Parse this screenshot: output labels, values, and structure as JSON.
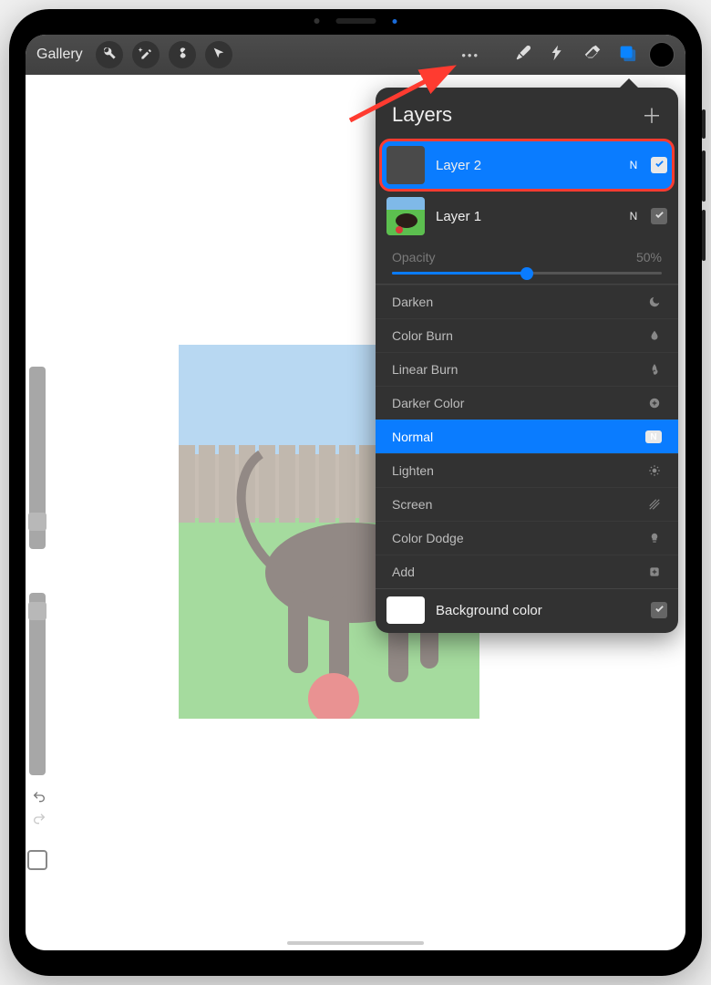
{
  "toolbar": {
    "gallery_label": "Gallery"
  },
  "layers_panel": {
    "title": "Layers",
    "layers": [
      {
        "name": "Layer 2",
        "mode_badge": "N",
        "selected": true,
        "thumb": "blank"
      },
      {
        "name": "Layer 1",
        "mode_badge": "N",
        "selected": false,
        "thumb": "photo"
      }
    ],
    "opacity_label": "Opacity",
    "opacity_value": "50%",
    "opacity_percent": 50,
    "blend_modes": [
      {
        "name": "Darken",
        "icon": "moon"
      },
      {
        "name": "Color Burn",
        "icon": "drop"
      },
      {
        "name": "Linear Burn",
        "icon": "flame"
      },
      {
        "name": "Darker Color",
        "icon": "circle-plus"
      },
      {
        "name": "Normal",
        "icon": "n-chip",
        "selected": true
      },
      {
        "name": "Lighten",
        "icon": "sun"
      },
      {
        "name": "Screen",
        "icon": "stripes"
      },
      {
        "name": "Color Dodge",
        "icon": "bulb"
      },
      {
        "name": "Add",
        "icon": "square-plus"
      }
    ],
    "background_label": "Background color",
    "background_swatch": "#ffffff"
  }
}
